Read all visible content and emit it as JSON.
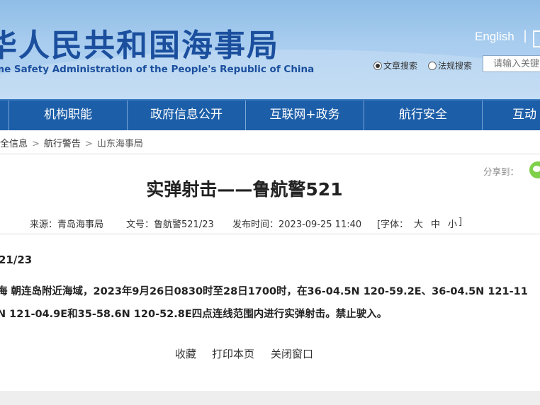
{
  "header": {
    "title_cn": "华人民共和国海事局",
    "title_en": "me Safety Administration of the People's Republic of China",
    "lang_link": "English",
    "lang_sep": "|",
    "search_options": [
      {
        "label": "文章搜索",
        "selected": true
      },
      {
        "label": "法规搜索",
        "selected": false
      }
    ],
    "search_placeholder": "请输入关键"
  },
  "nav": {
    "items": [
      "机构职能",
      "政府信息公开",
      "互联网+政务",
      "航行安全",
      "互动"
    ]
  },
  "breadcrumb": {
    "items": [
      "全信息",
      "航行警告",
      "山东海事局"
    ],
    "separator": ">"
  },
  "article": {
    "share_label": "分享到：",
    "title": "实弹射击——鲁航警521",
    "meta": {
      "source": "来源：青岛海事局",
      "doc_no": "文号：鲁航警521/23",
      "published": "发布时间：2023-09-25 11:40",
      "font_label": "[字体：",
      "font_large": "大",
      "font_medium": "中",
      "font_small": "小",
      "font_close": "]"
    },
    "code": "21/23",
    "line1": "海  朝连岛附近海域，2023年9月26日0830时至28日1700时，在36-04.5N 120-59.2E、36-04.5N 121-11",
    "line2": "N 121-04.9E和35-58.6N 120-52.8E四点连线范围内进行实弹射击。禁止驶入。"
  },
  "actions": {
    "favorite": "收藏",
    "print": "打印本页",
    "close": "关闭窗口"
  },
  "colors": {
    "nav_bg": "#1c5ea8",
    "title_blue": "#1b4f9e",
    "header_sky": "#a9cdef"
  }
}
